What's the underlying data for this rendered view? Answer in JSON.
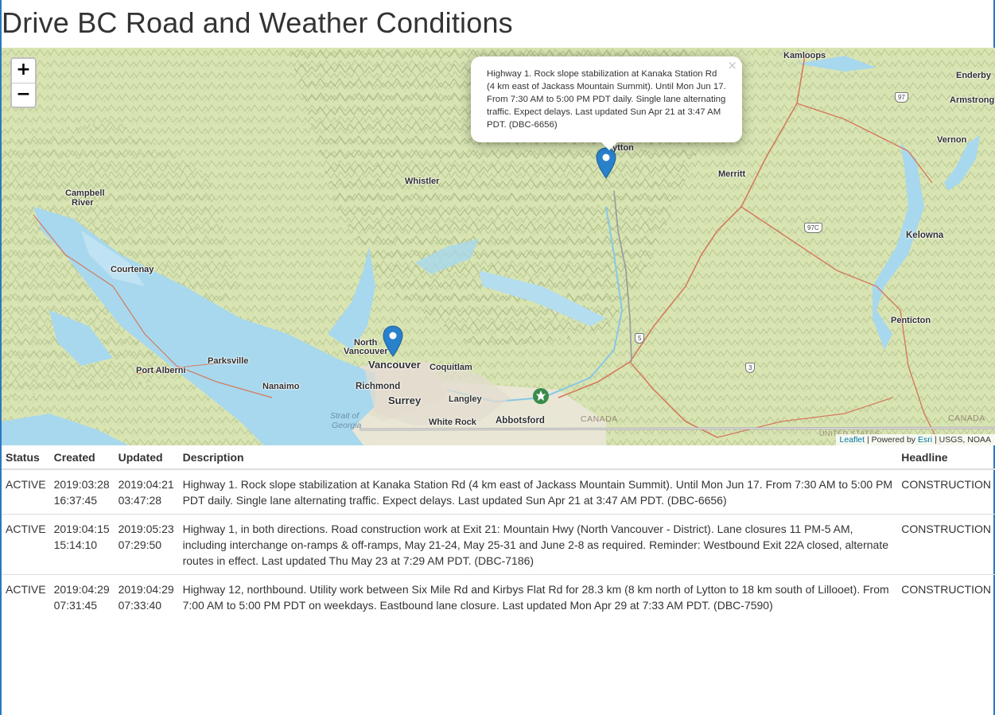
{
  "page": {
    "title": "Drive BC Road and Weather Conditions"
  },
  "map": {
    "zoom_in": "+",
    "zoom_out": "−",
    "popup": {
      "close": "×",
      "text": "Highway 1. Rock slope stabilization at Kanaka Station Rd (4 km east of Jackass Mountain Summit). Until Mon Jun 17. From 7:30 AM to 5:00 PM PDT daily. Single lane alternating traffic. Expect delays. Last updated Sun Apr 21 at 3:47 AM PDT. (DBC-6656)"
    },
    "labels": {
      "kamloops": "Kamloops",
      "enderby": "Enderby",
      "armstrong": "Armstrong",
      "vernon": "Vernon",
      "merritt": "Merritt",
      "kelowna": "Kelowna",
      "penticton": "Penticton",
      "lytton": "ytton",
      "whistler": "Whistler",
      "campbell": "Campbell",
      "river": "River",
      "courtenay": "Courtenay",
      "north": "North",
      "vancouver_n": "Vancouver",
      "vancouver": "Vancouver",
      "coquitlam": "Coquitlam",
      "richmond": "Richmond",
      "surrey": "Surrey",
      "langley": "Langley",
      "abbotsford": "Abbotsford",
      "white_rock": "White Rock",
      "parksville": "Parksville",
      "port_alberni": "Port Alberni",
      "nanaimo": "Nanaimo",
      "strait1": "Strait of",
      "strait2": "Georgia",
      "canada1": "CANADA",
      "canada2": "CANADA",
      "us": "UNITED STATES"
    },
    "shields": {
      "hwy97": "97",
      "hwy97c": "97C",
      "hwy5": "5",
      "hwy3": "3"
    },
    "attribution": {
      "leaflet": "Leaflet",
      "powered": " | Powered by ",
      "esri": "Esri",
      "source": " | USGS, NOAA"
    }
  },
  "table": {
    "headers": {
      "status": "Status",
      "created": "Created",
      "updated": "Updated",
      "description": "Description",
      "headline": "Headline"
    },
    "rows": [
      {
        "status": "ACTIVE",
        "created_date": "2019:03:28",
        "created_time": "16:37:45",
        "updated_date": "2019:04:21",
        "updated_time": "03:47:28",
        "description": "Highway 1. Rock slope stabilization at Kanaka Station Rd (4 km east of Jackass Mountain Summit). Until Mon Jun 17. From 7:30 AM to 5:00 PM PDT daily. Single lane alternating traffic. Expect delays. Last updated Sun Apr 21 at 3:47 AM PDT. (DBC-6656)",
        "headline": "CONSTRUCTION"
      },
      {
        "status": "ACTIVE",
        "created_date": "2019:04:15",
        "created_time": "15:14:10",
        "updated_date": "2019:05:23",
        "updated_time": "07:29:50",
        "description": "Highway 1, in both directions. Road construction work at Exit 21: Mountain Hwy (North Vancouver - District). Lane closures 11 PM-5 AM, including interchange on-ramps & off-ramps, May 21-24, May 25-31 and June 2-8 as required. Reminder: Westbound Exit 22A closed, alternate routes in effect. Last updated Thu May 23 at 7:29 AM PDT. (DBC-7186)",
        "headline": "CONSTRUCTION"
      },
      {
        "status": "ACTIVE",
        "created_date": "2019:04:29",
        "created_time": "07:31:45",
        "updated_date": "2019:04:29",
        "updated_time": "07:33:40",
        "description": "Highway 12, northbound. Utility work between Six Mile Rd and Kirbys Flat Rd for 28.3 km (8 km north of Lytton to 18 km south of Lillooet). From 7:00 AM to 5:00 PM PDT on weekdays. Eastbound lane closure. Last updated Mon Apr 29 at 7:33 AM PDT. (DBC-7590)",
        "headline": "CONSTRUCTION"
      }
    ]
  }
}
